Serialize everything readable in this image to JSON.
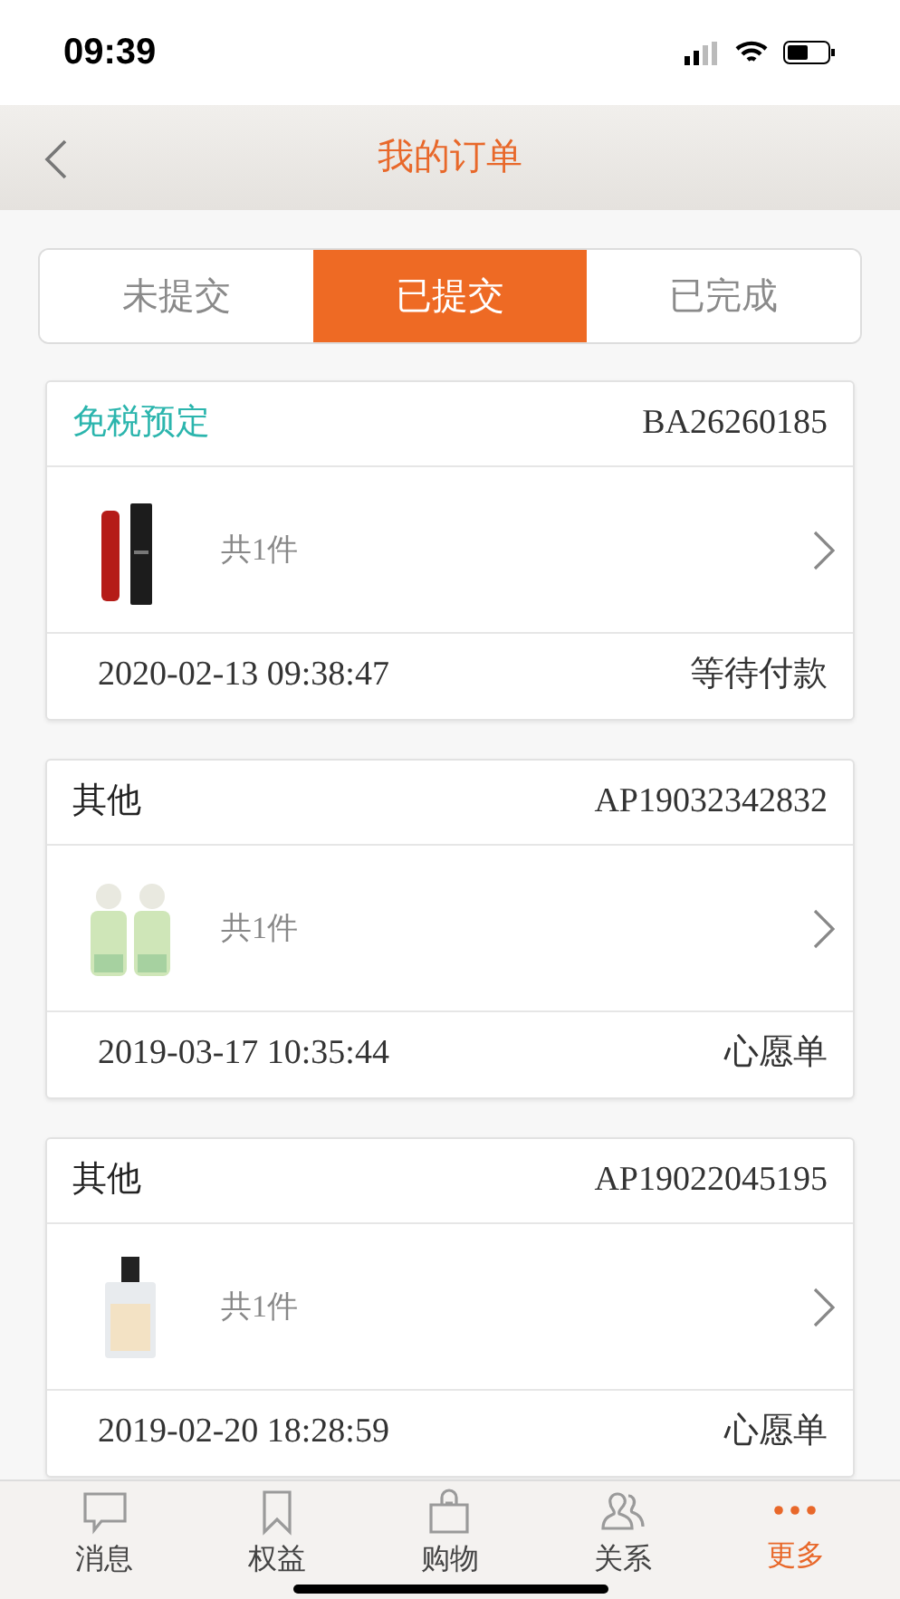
{
  "status_bar": {
    "time": "09:39"
  },
  "header": {
    "title": "我的订单"
  },
  "tabs": [
    {
      "label": "未提交",
      "selected": false
    },
    {
      "label": "已提交",
      "selected": true
    },
    {
      "label": "已完成",
      "selected": false
    }
  ],
  "orders": [
    {
      "type": "免税预定",
      "color": "#2bb5ad",
      "number": "BA26260185",
      "count": "共1件",
      "date": "2020-02-13 09:38:47",
      "status": "等待付款"
    },
    {
      "type": "其他",
      "color": "#222222",
      "number": "AP19032342832",
      "count": "共1件",
      "date": "2019-03-17 10:35:44",
      "status": "心愿单"
    },
    {
      "type": "其他",
      "color": "#222222",
      "number": "AP19022045195",
      "count": "共1件",
      "date": "2019-02-20 18:28:59",
      "status": "心愿单"
    }
  ],
  "tab_bar": [
    {
      "label": "消息",
      "selected": false
    },
    {
      "label": "权益",
      "selected": false
    },
    {
      "label": "购物",
      "selected": false
    },
    {
      "label": "关系",
      "selected": false
    },
    {
      "label": "更多",
      "selected": true
    }
  ]
}
